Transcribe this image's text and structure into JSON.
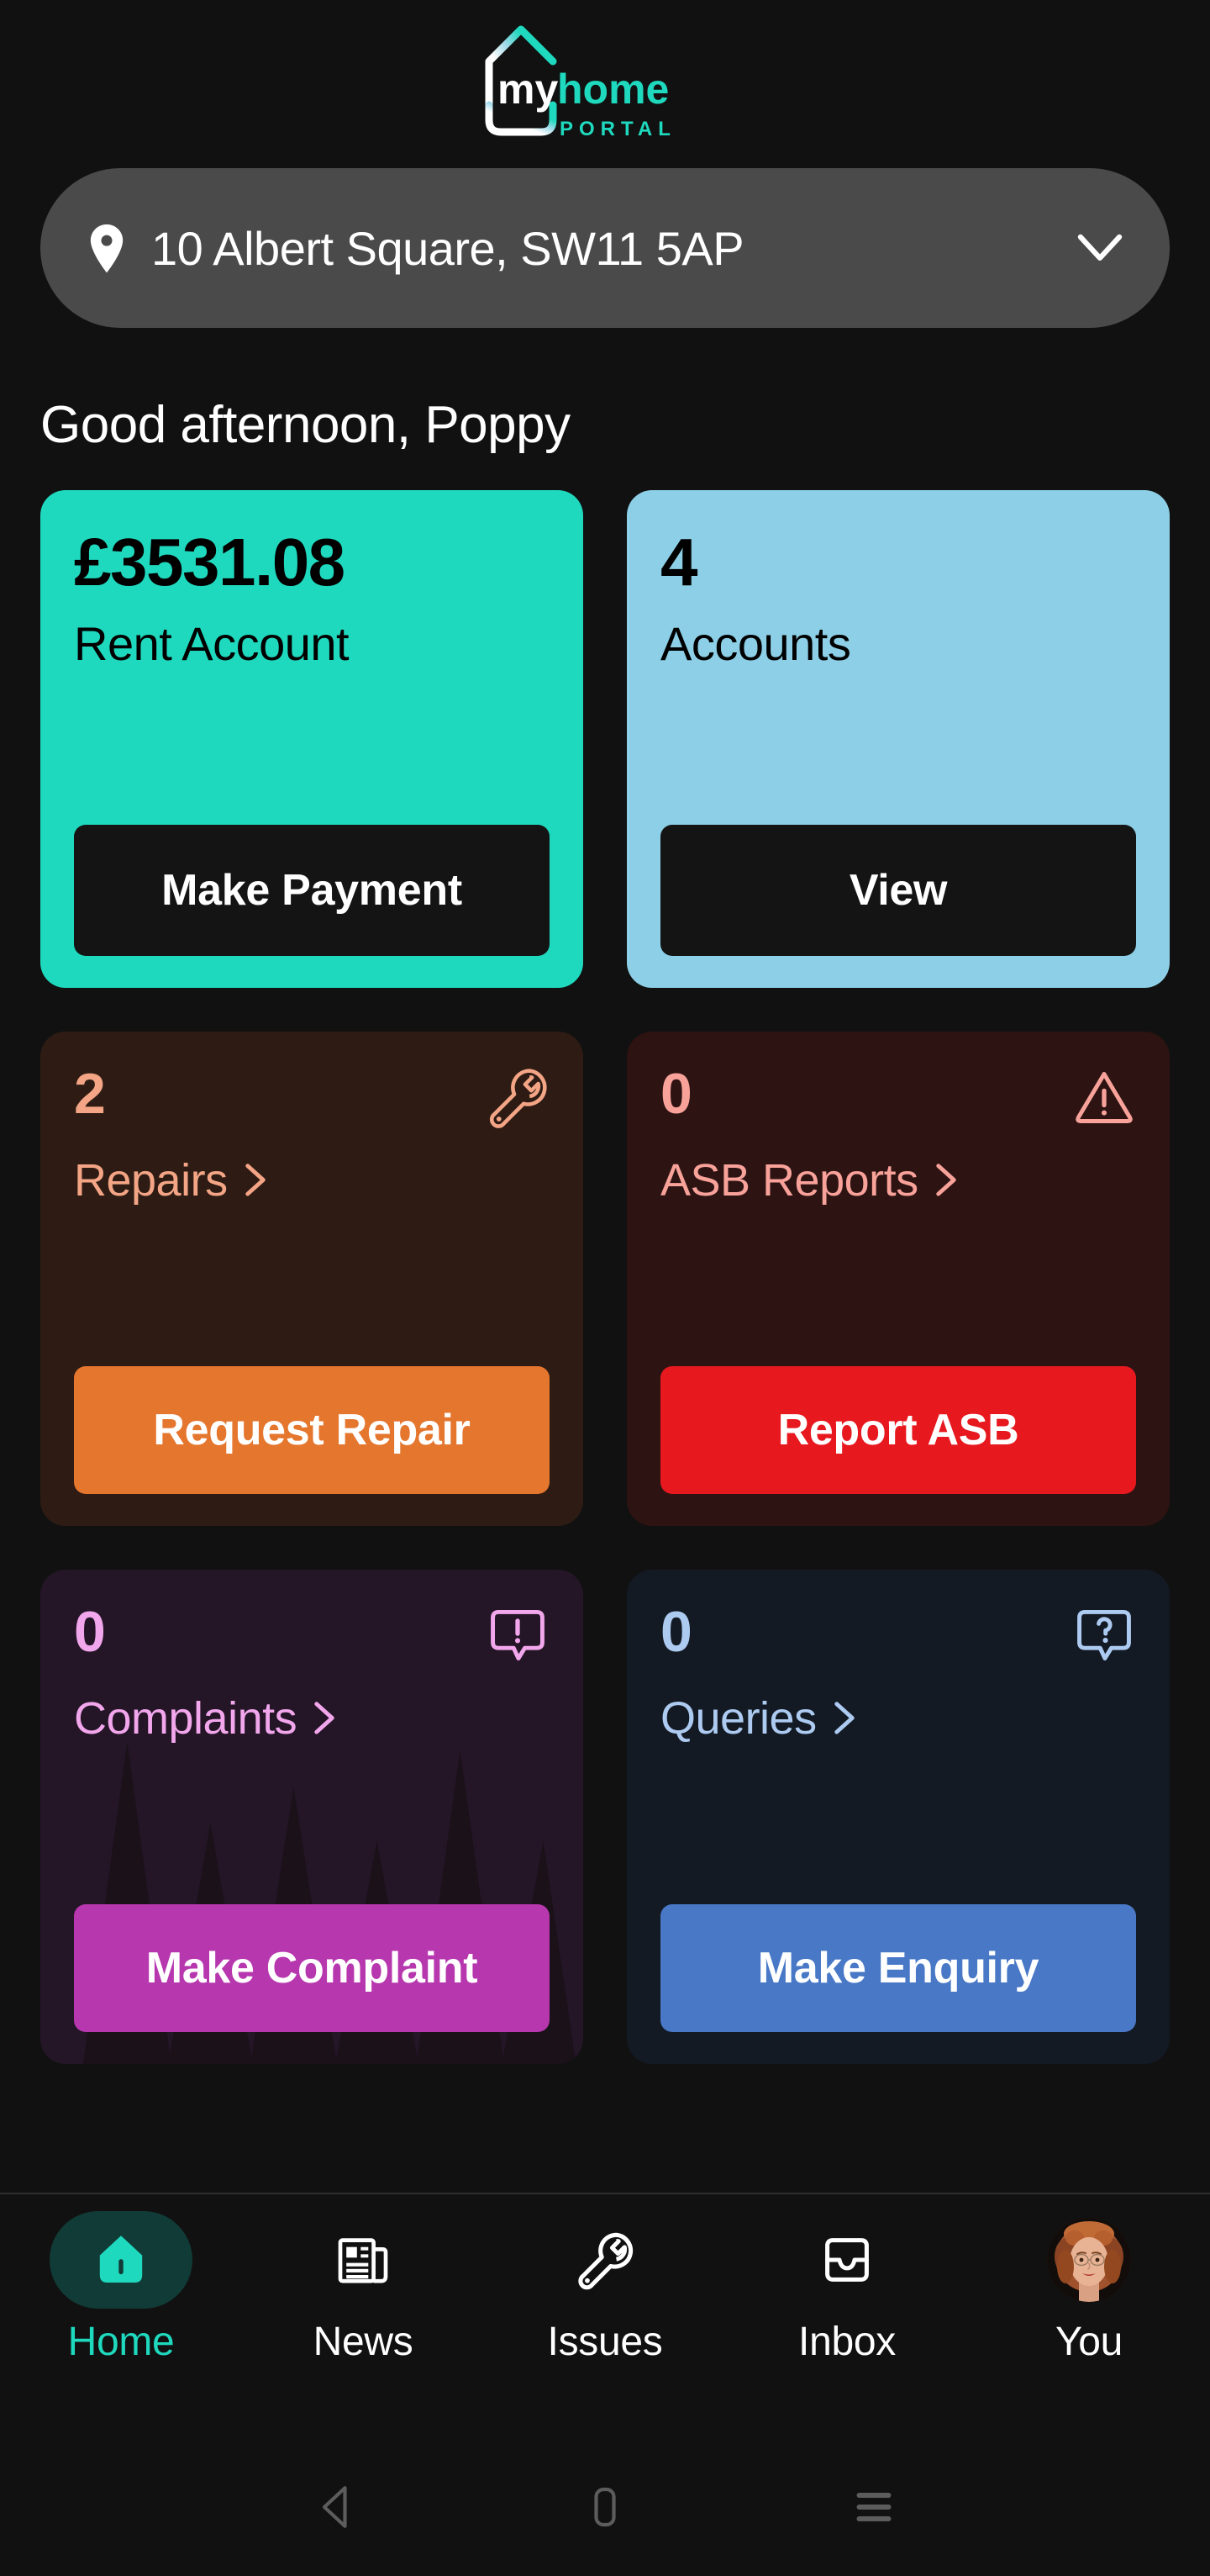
{
  "app": {
    "logo": {
      "word_my": "my",
      "word_home": "home",
      "word_portal": "PORTAL",
      "teal": "#1FD9BE",
      "white": "#FFFFFF"
    }
  },
  "address_selector": {
    "icon": "location-pin-icon",
    "value": "10 Albert Square, SW11 5AP",
    "chevron": "chevron-down-icon"
  },
  "greeting": "Good afternoon, Poppy",
  "cards": {
    "rent": {
      "metric": "£3531.08",
      "label": "Rent Account",
      "cta": "Make Payment",
      "bg": "#1FD9BE",
      "cta_bg": "#141414"
    },
    "accounts": {
      "metric": "4",
      "label": "Accounts",
      "cta": "View",
      "bg": "#8CCFE6",
      "cta_bg": "#141414"
    },
    "repairs": {
      "count": "2",
      "label": "Repairs",
      "cta": "Request Repair",
      "icon": "wrench-icon",
      "bg": "#2E1C14",
      "accent": "#F4A585",
      "cta_bg": "#E5762E"
    },
    "asb": {
      "count": "0",
      "label": "ASB Reports",
      "cta": "Report ASB",
      "icon": "warning-triangle-icon",
      "bg": "#2D1312",
      "accent": "#F8A29A",
      "cta_bg": "#E7191F"
    },
    "complaints": {
      "count": "0",
      "label": "Complaints",
      "cta": "Make Complaint",
      "icon": "speech-bubble-exclamation-icon",
      "bg": "#241527",
      "accent": "#F2A6EC",
      "cta_bg": "#B737AE"
    },
    "queries": {
      "count": "0",
      "label": "Queries",
      "cta": "Make Enquiry",
      "icon": "speech-bubble-question-icon",
      "bg": "#131A24",
      "accent": "#ADCAF1",
      "cta_bg": "#4878C6"
    }
  },
  "bottom_nav": {
    "active": "Home",
    "items": [
      {
        "label": "Home",
        "icon": "house-icon"
      },
      {
        "label": "News",
        "icon": "newspaper-icon"
      },
      {
        "label": "Issues",
        "icon": "wrench-icon"
      },
      {
        "label": "Inbox",
        "icon": "inbox-tray-icon"
      },
      {
        "label": "You",
        "icon": "user-avatar-photo"
      }
    ]
  },
  "system_nav": {
    "back": "back-triangle-icon",
    "home": "home-pill-icon",
    "recents": "recents-lines-icon"
  }
}
